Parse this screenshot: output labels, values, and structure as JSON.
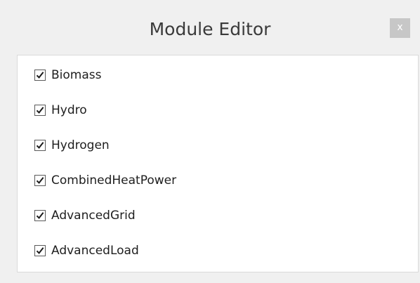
{
  "window": {
    "title": "Module Editor",
    "close_label": "x"
  },
  "modules": [
    {
      "label": "Biomass",
      "checked": true
    },
    {
      "label": "Hydro",
      "checked": true
    },
    {
      "label": "Hydrogen",
      "checked": true
    },
    {
      "label": "CombinedHeatPower",
      "checked": true
    },
    {
      "label": "AdvancedGrid",
      "checked": true
    },
    {
      "label": "AdvancedLoad",
      "checked": true
    }
  ],
  "colors": {
    "background": "#f0f0f0",
    "panel": "#ffffff",
    "close_button": "#c7c7c7",
    "text": "#1e1e1e"
  }
}
